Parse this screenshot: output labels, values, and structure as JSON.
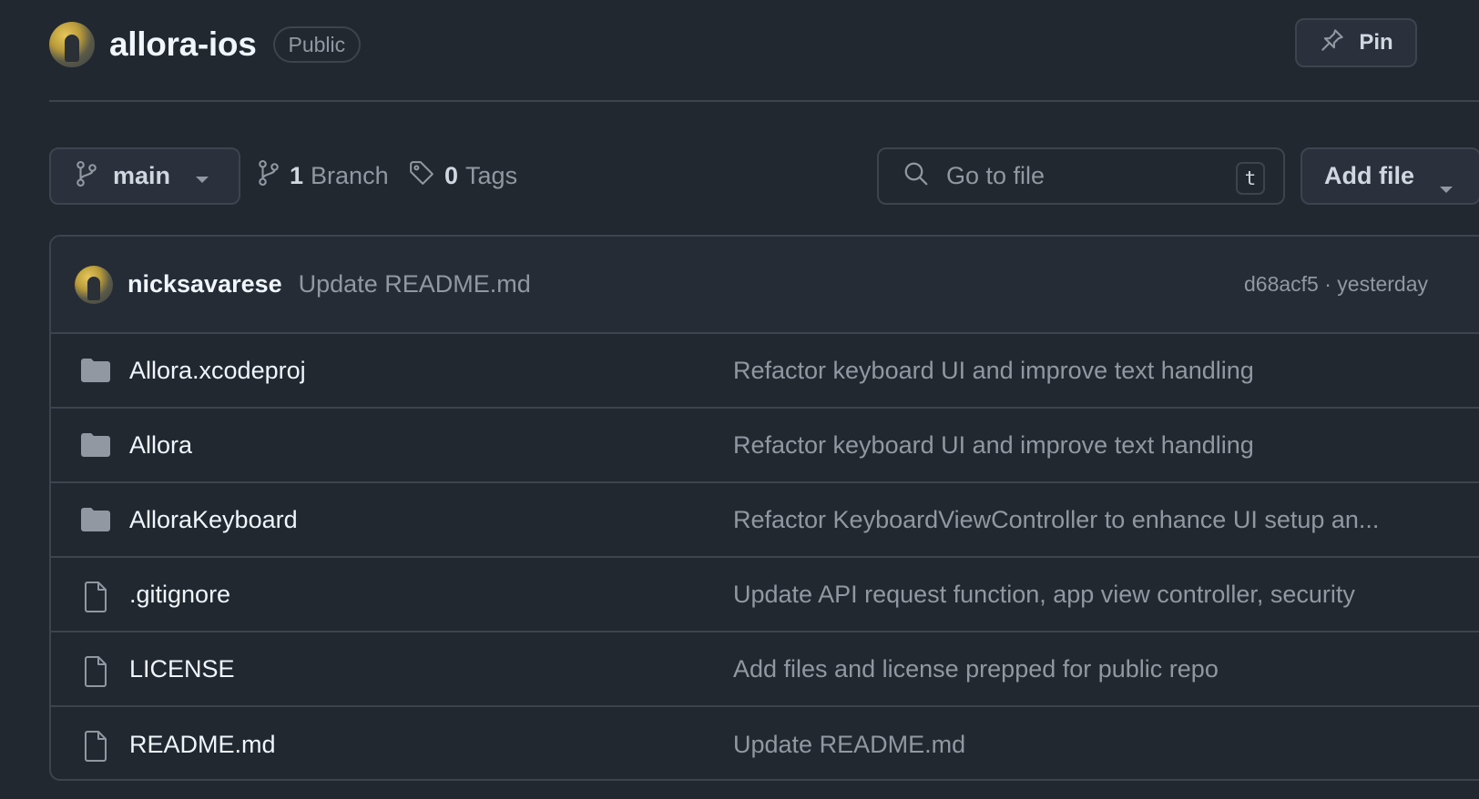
{
  "repo": {
    "name": "allora-ios",
    "visibility": "Public",
    "pin_label": "Pin"
  },
  "toolbar": {
    "branch": "main",
    "branch_count": "1",
    "branch_label": "Branch",
    "tag_count": "0",
    "tag_label": "Tags",
    "search_placeholder": "Go to file",
    "search_shortcut": "t",
    "add_file_label": "Add file"
  },
  "latest_commit": {
    "author": "nicksavarese",
    "message": "Update README.md",
    "meta": "d68acf5 · yesterday"
  },
  "files": [
    {
      "type": "folder",
      "name": "Allora.xcodeproj",
      "commit": "Refactor keyboard UI and improve text handling"
    },
    {
      "type": "folder",
      "name": "Allora",
      "commit": "Refactor keyboard UI and improve text handling"
    },
    {
      "type": "folder",
      "name": "AlloraKeyboard",
      "commit": "Refactor KeyboardViewController to enhance UI setup an..."
    },
    {
      "type": "file",
      "name": ".gitignore",
      "commit": "Update API request function, app view controller, security"
    },
    {
      "type": "file",
      "name": "LICENSE",
      "commit": "Add files and license prepped for public repo"
    },
    {
      "type": "file",
      "name": "README.md",
      "commit": "Update README.md"
    }
  ],
  "colors": {
    "background": "#212830",
    "border": "#3d444d",
    "text_primary": "#f0f6fc",
    "text_muted": "#9198a1",
    "folder_icon": "#9198a1"
  },
  "icons": {
    "pin": "pin-icon",
    "branch": "git-branch-icon",
    "tag": "tag-icon",
    "search": "search-icon",
    "folder": "folder-icon",
    "file": "file-icon",
    "caret": "triangle-down-icon"
  }
}
